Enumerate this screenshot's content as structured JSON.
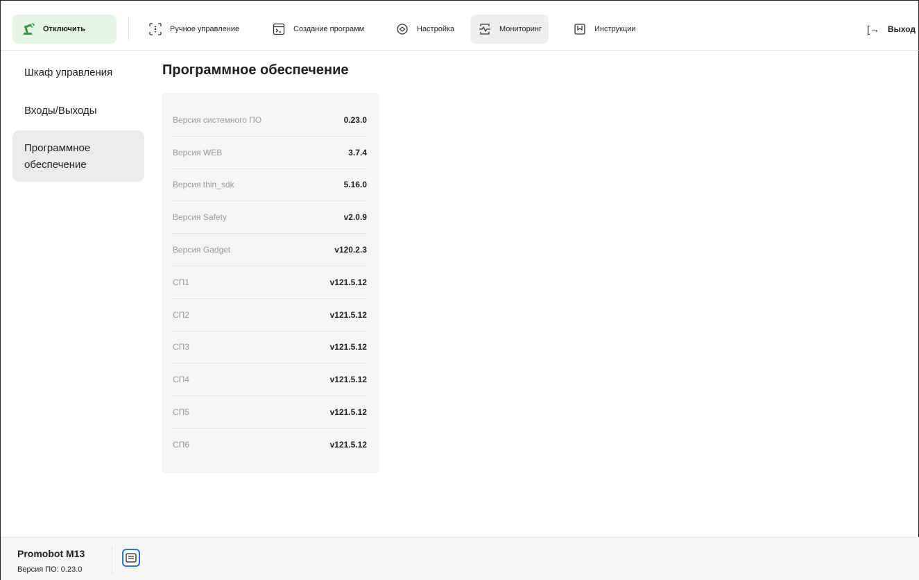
{
  "topbar": {
    "disconnect_label": "Отключить",
    "nav": [
      {
        "label": "Ручное управление",
        "icon": "manual-control-icon"
      },
      {
        "label": "Создание программ",
        "icon": "terminal-icon"
      },
      {
        "label": "Настройка",
        "icon": "settings-icon"
      },
      {
        "label": "Мониторинг",
        "icon": "monitoring-icon",
        "active": true
      },
      {
        "label": "Инструкции",
        "icon": "bookmark-icon"
      }
    ],
    "exit_label": "Выход"
  },
  "sidebar": {
    "items": [
      {
        "label": "Шкаф управления"
      },
      {
        "label": "Входы/Выходы"
      },
      {
        "label": "Программное обеспечение",
        "active": true
      }
    ]
  },
  "main": {
    "title": "Программное обеспечение",
    "rows": [
      {
        "label": "Версия системного ПО",
        "value": "0.23.0"
      },
      {
        "label": "Версия WEB",
        "value": "3.7.4"
      },
      {
        "label": "Версия thin_sdk",
        "value": "5.16.0"
      },
      {
        "label": "Версия Safety",
        "value": "v2.0.9"
      },
      {
        "label": "Версия Gadget",
        "value": "v120.2.3"
      },
      {
        "label": "СП1",
        "value": "v121.5.12"
      },
      {
        "label": "СП2",
        "value": "v121.5.12"
      },
      {
        "label": "СП3",
        "value": "v121.5.12"
      },
      {
        "label": "СП4",
        "value": "v121.5.12"
      },
      {
        "label": "СП5",
        "value": "v121.5.12"
      },
      {
        "label": "СП6",
        "value": "v121.5.12"
      }
    ]
  },
  "footer": {
    "robot_name": "Promobot M13",
    "software_version": "Версия ПО: 0.23.0"
  },
  "colors": {
    "accent_green_bg": "#e6f6e6",
    "robot_icon_green": "#2e9b3a",
    "footer_button_blue": "#2a6fd6"
  }
}
